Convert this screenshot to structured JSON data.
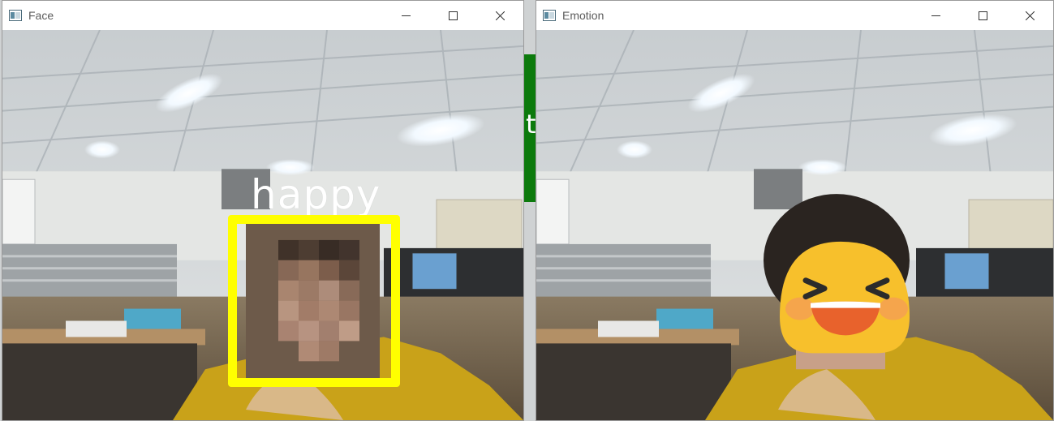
{
  "windows": {
    "face": {
      "title": "Face",
      "emotion_label": "happy",
      "box_color": "#ffff00"
    },
    "emotion": {
      "title": "Emotion",
      "emoji": "laughing-face-emoji",
      "emoji_color": "#f7c02c"
    }
  },
  "background_fragment": "ti",
  "icons": {
    "app": "app-window-icon",
    "minimize": "minimize-icon",
    "maximize": "maximize-icon",
    "close": "close-icon"
  }
}
